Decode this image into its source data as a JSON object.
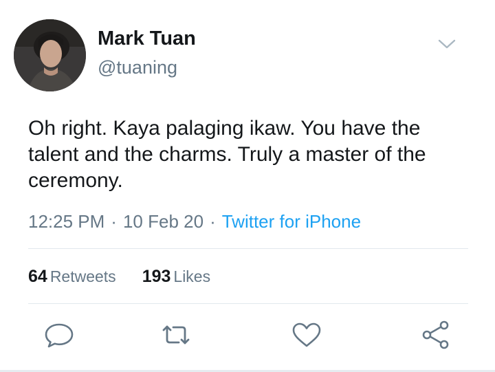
{
  "author": {
    "display_name": "Mark Tuan",
    "handle": "@tuaning"
  },
  "tweet": {
    "text": "Oh right. Kaya palaging ikaw. You have the talent and the charms. Truly a master of the ceremony."
  },
  "meta": {
    "time": "12:25 PM",
    "date": "10 Feb 20",
    "separator": "·",
    "source": "Twitter for iPhone"
  },
  "stats": {
    "retweets_count": "64",
    "retweets_label": "Retweets",
    "likes_count": "193",
    "likes_label": "Likes"
  },
  "icons": {
    "menu": "chevron-down-icon",
    "reply": "reply-icon",
    "retweet": "retweet-icon",
    "like": "heart-icon",
    "share": "share-icon"
  },
  "colors": {
    "text": "#14171a",
    "secondary": "#657786",
    "link": "#1da1f2",
    "icon": "#657786",
    "divider": "#e1e8ed"
  }
}
